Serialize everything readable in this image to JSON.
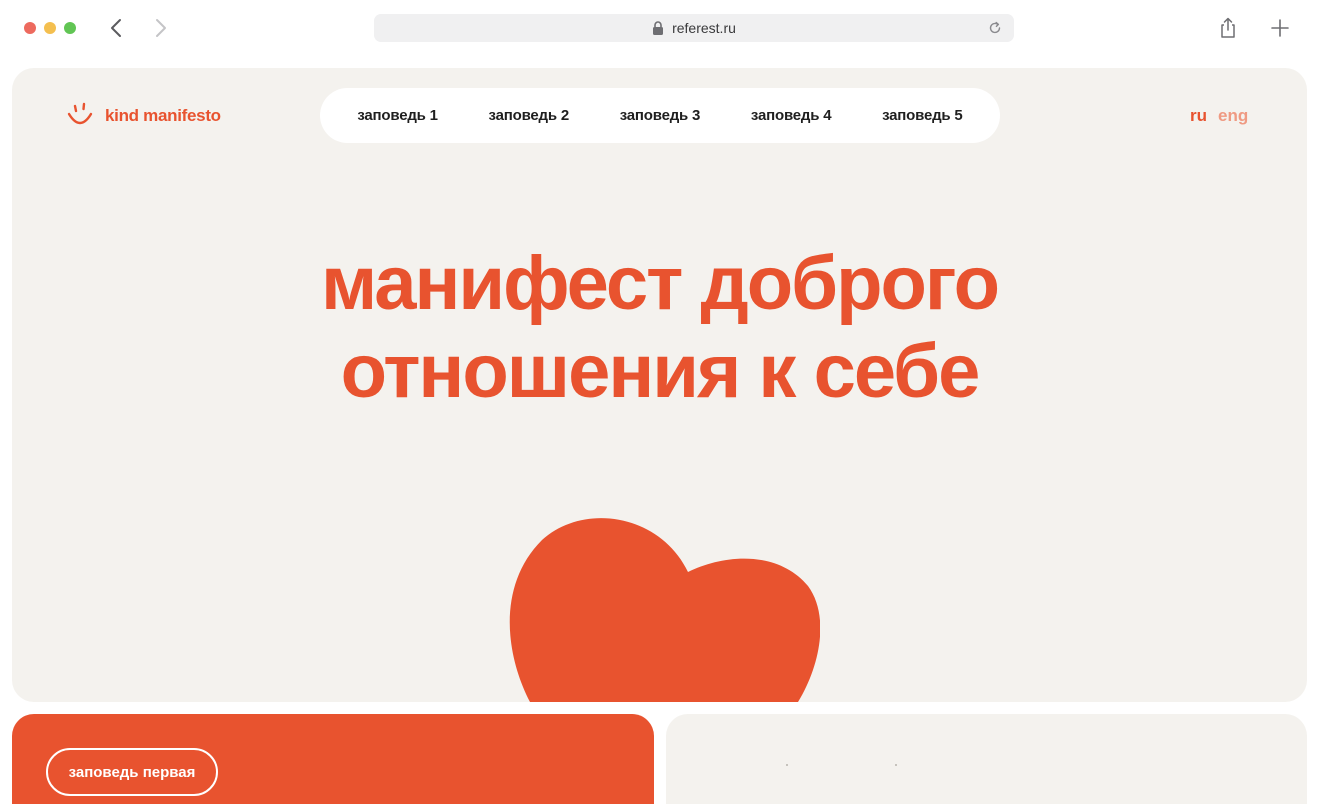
{
  "browser": {
    "url": "referest.ru",
    "icons": [
      "back-icon",
      "forward-icon",
      "lock-icon",
      "reload-icon",
      "share-icon",
      "plus-icon"
    ]
  },
  "site": {
    "logo_text": "kind manifesto",
    "nav": [
      {
        "label": "заповедь 1"
      },
      {
        "label": "заповедь 2"
      },
      {
        "label": "заповедь 3"
      },
      {
        "label": "заповедь 4"
      },
      {
        "label": "заповедь 5"
      }
    ],
    "lang": {
      "ru": "ru",
      "eng": "eng",
      "active": "ru"
    },
    "hero_title_line1": "манифест доброго",
    "hero_title_line2": "отношения к себе",
    "card_button": "заповедь первая"
  },
  "colors": {
    "accent": "#e8532f",
    "background": "#f4f2ee",
    "nav_pill": "#ffffff",
    "lang_inactive": "#ef9a82"
  }
}
